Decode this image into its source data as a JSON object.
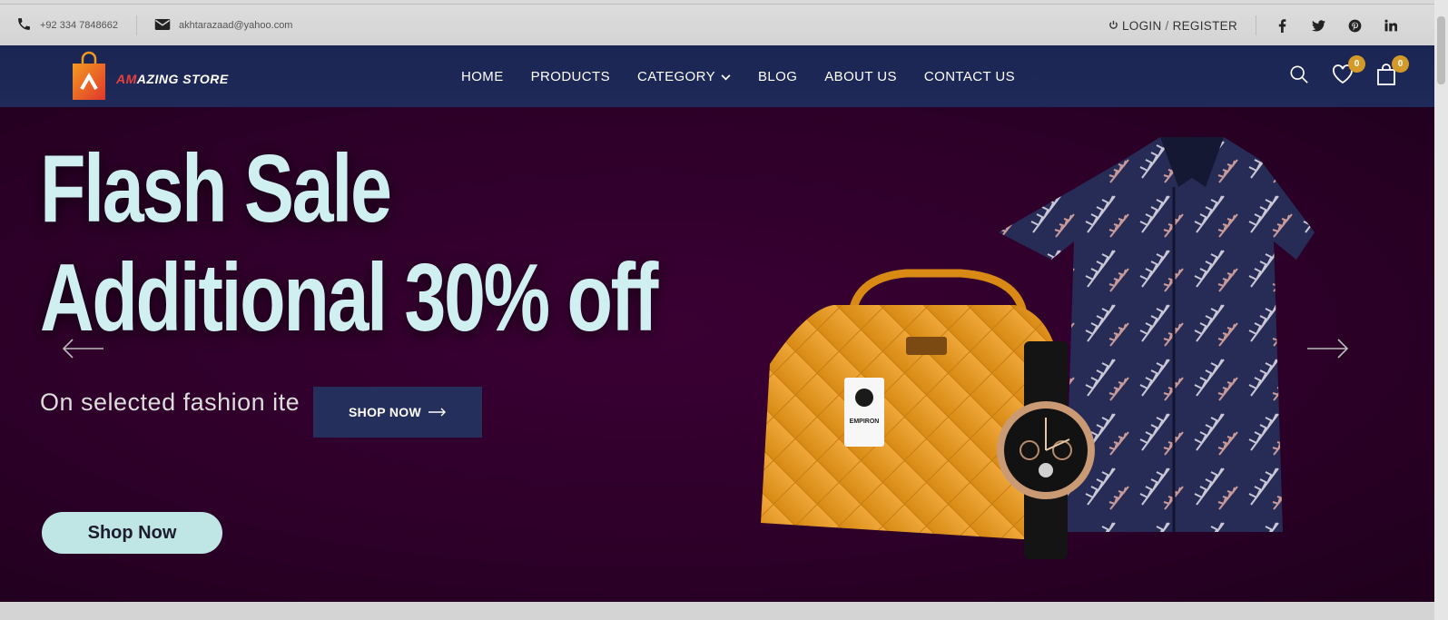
{
  "topbar": {
    "phone": "+92 334 7848662",
    "email": "akhtarazaad@yahoo.com",
    "login_label": "LOGIN",
    "register_label": "REGISTER",
    "social": [
      "facebook",
      "twitter",
      "pinterest",
      "linkedin"
    ]
  },
  "nav": {
    "brand_a": "A",
    "brand_m": "M",
    "brand_rest": "AZING STORE",
    "menu": [
      {
        "label": "HOME"
      },
      {
        "label": "PRODUCTS"
      },
      {
        "label": "CATEGORY"
      },
      {
        "label": "BLOG"
      },
      {
        "label": "ABOUT US"
      },
      {
        "label": "CONTACT US"
      }
    ],
    "wishlist_count": "0",
    "cart_count": "0"
  },
  "hero": {
    "headline_line1": "Flash Sale",
    "headline_line2": "Additional 30% off",
    "subline": "On selected fashion ite",
    "shop_button": "SHOP NOW",
    "pill_button": "Shop Now",
    "tag_brand": "EMPIRON"
  },
  "colors": {
    "nav_bg": "#1f2957",
    "hero_bg": "#2c0028",
    "headline": "#cfeff0",
    "badge": "#d39a2a",
    "shop_button_bg": "#252f5c",
    "pill_bg": "#bfe5e4"
  }
}
